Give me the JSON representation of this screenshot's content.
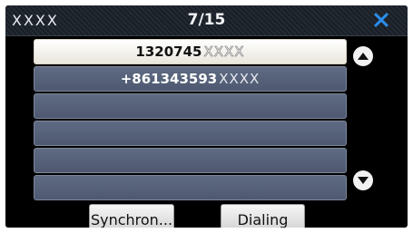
{
  "header": {
    "title_left": "XXXX",
    "page_indicator": "7/15",
    "close_icon": "close-icon",
    "accent_color": "#2a8ff0"
  },
  "contacts": {
    "rows": [
      {
        "number": "1320745",
        "masked": "XXXX",
        "selected": true
      },
      {
        "number": "+861343593",
        "masked": "XXXX",
        "selected": false
      },
      {
        "number": "",
        "masked": "",
        "selected": false
      },
      {
        "number": "",
        "masked": "",
        "selected": false
      },
      {
        "number": "",
        "masked": "",
        "selected": false
      },
      {
        "number": "",
        "masked": "",
        "selected": false
      }
    ]
  },
  "scroll": {
    "up_icon": "triangle-up-icon",
    "down_icon": "triangle-down-icon"
  },
  "footer": {
    "sync_label": "Synchron...",
    "dial_label": "Dialing"
  }
}
